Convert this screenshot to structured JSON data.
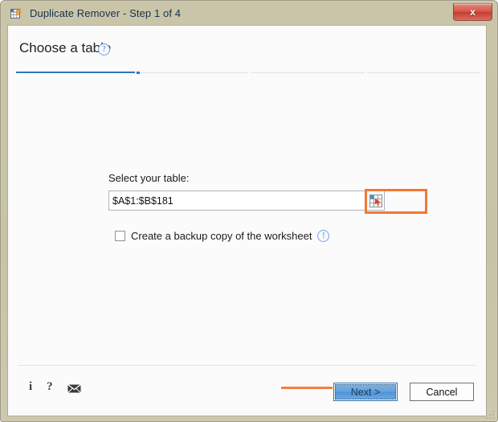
{
  "window": {
    "title": "Duplicate Remover - Step 1 of 4",
    "app_icon": "duplicate-remover-icon",
    "close_label": "x",
    "frame_color": "#c9c4a8"
  },
  "header": {
    "page_title": "Choose a table",
    "help_icon": "?",
    "help_icon_name": "question-circle-icon"
  },
  "stepper": {
    "current_step": 1,
    "total_steps": 4,
    "fill_color": "#2f76bb",
    "track_color": "#e2e2e2"
  },
  "form": {
    "select_label": "Select your table:",
    "range_value": "$A$1:$B$181",
    "range_placeholder": "$A$1:$B$181",
    "range_picker_icon": "range-select-icon",
    "backup_label": "Create a backup copy of the worksheet",
    "backup_checked": false,
    "backup_info_icon": "!",
    "backup_info_icon_name": "info-circle-icon"
  },
  "footer": {
    "info_icon": "i",
    "help_icon": "?",
    "mail_icon": "envelope-icon",
    "next_label": "Next >",
    "cancel_label": "Cancel"
  },
  "annotations": {
    "range_highlight_color": "#f37735",
    "arrow_color": "#f97b41",
    "arrow_target": "next-button"
  }
}
